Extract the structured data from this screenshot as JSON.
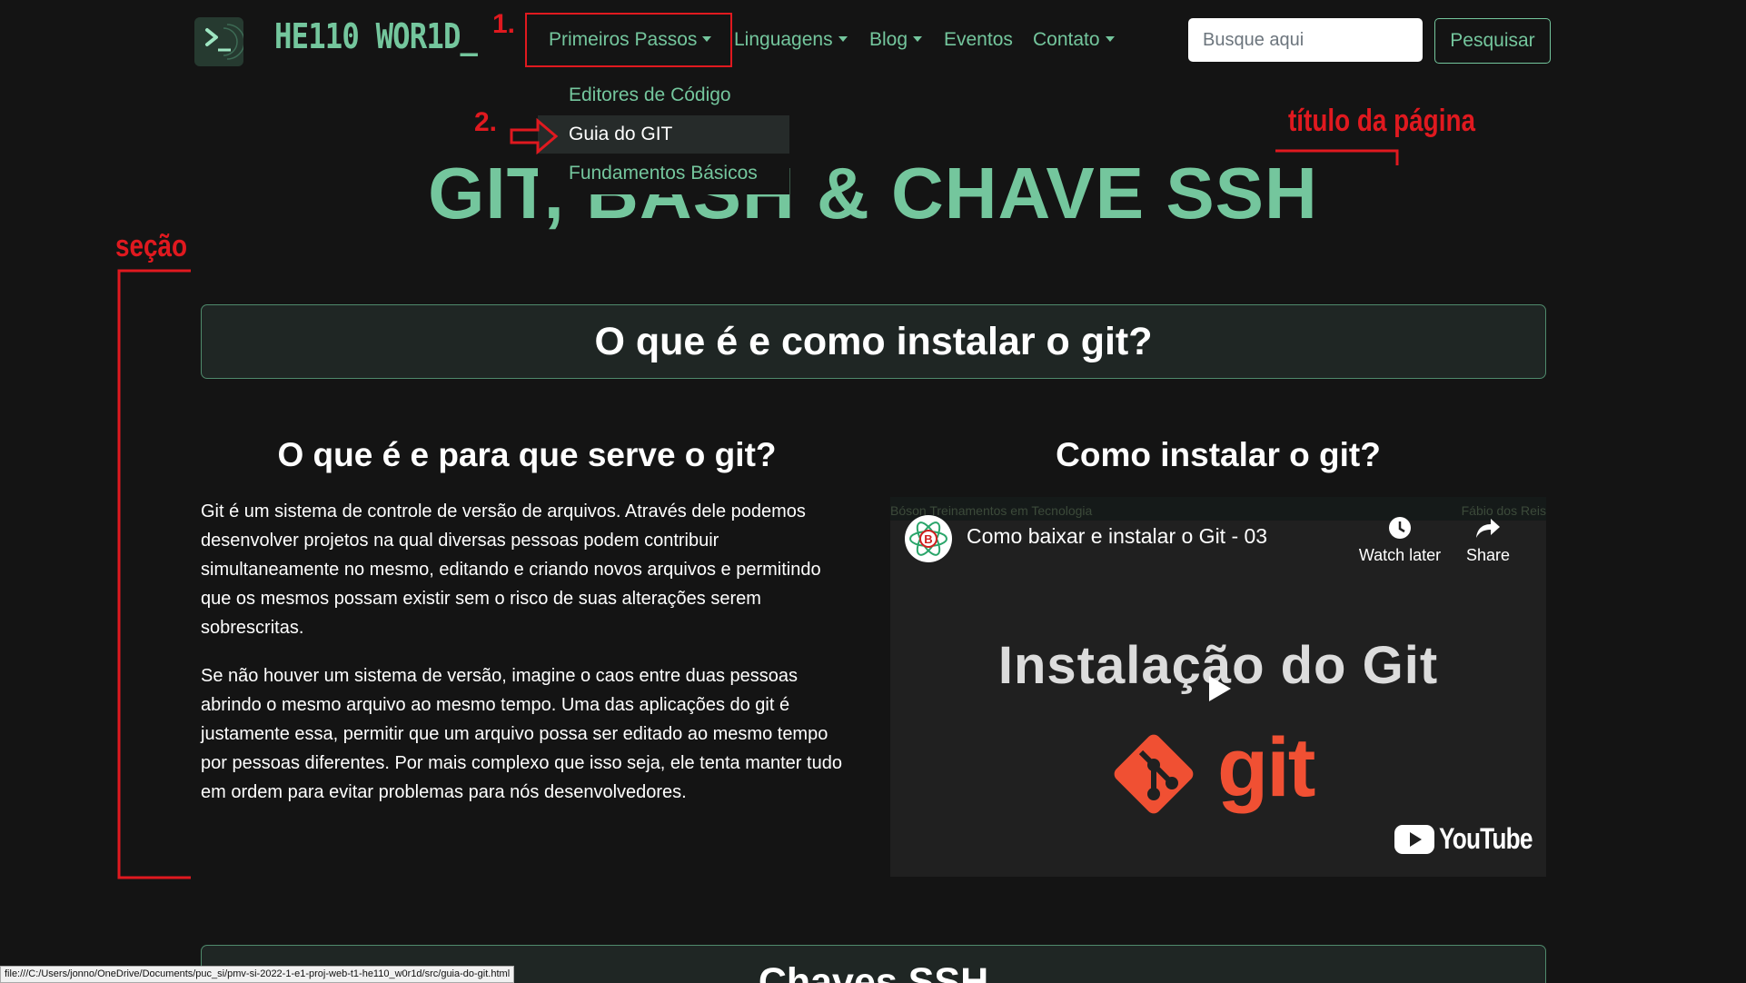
{
  "brand": {
    "name": "HE110 WOR1D_"
  },
  "nav": {
    "items": [
      {
        "label": "Primeiros Passos",
        "dropdown": true
      },
      {
        "label": "Linguagens",
        "dropdown": true
      },
      {
        "label": "Blog",
        "dropdown": true
      },
      {
        "label": "Eventos",
        "dropdown": false
      },
      {
        "label": "Contato",
        "dropdown": true
      }
    ],
    "search_placeholder": "Busque aqui",
    "search_button": "Pesquisar"
  },
  "dropdown": {
    "items": [
      {
        "label": "Editores de Código",
        "active": false
      },
      {
        "label": "Guia do GIT",
        "active": true
      },
      {
        "label": "Fundamentos Básicos",
        "active": false
      }
    ]
  },
  "page_title": "GIT, BASH & CHAVE SSH",
  "section": {
    "header": "O que é e como instalar o git?",
    "left_title": "O que é e para que serve o git?",
    "paragraphs": [
      "Git é um sistema de controle de versão de arquivos. Através dele podemos desenvolver projetos na qual diversas pessoas podem contribuir simultaneamente no mesmo, editando e criando novos arquivos e permitindo que os mesmos possam existir sem o risco de suas alterações serem sobrescritas.",
      "Se não houver um sistema de versão, imagine o caos entre duas pessoas abrindo o mesmo arquivo ao mesmo tempo. Uma das aplicações do git é justamente essa, permitir que um arquivo possa ser editado ao mesmo tempo por pessoas diferentes. Por mais complexo que isso seja, ele tenta manter tudo em ordem para evitar problemas para nós desenvolvedores."
    ],
    "right_title": "Como instalar o git?"
  },
  "video": {
    "strip_left": "Bóson Treinamentos em Tecnologia",
    "strip_right": "Fábio dos Reis",
    "title": "Como baixar e instalar o Git - 03",
    "watch_later": "Watch later",
    "share": "Share",
    "thumb_heading": "Instalação do Git",
    "thumb_logo_text": "git",
    "platform": "YouTube",
    "colors": {
      "git_orange": "#f05033",
      "youtube_white": "#ffffff"
    }
  },
  "next_section": {
    "header": "Chaves SSH"
  },
  "statusbar": {
    "url": "file:///C:/Users/jonno/OneDrive/Documents/puc_si/pmv-si-2022-1-e1-proj-web-t1-he110_w0r1d/src/guia-do-git.html"
  },
  "annotations": {
    "step1": "1.",
    "step2": "2.",
    "page_title_label": "título da página",
    "section_label": "seção"
  },
  "colors": {
    "accent": "#74c69d",
    "background": "#141414",
    "annotation_red": "#e0191f",
    "section_bg": "#1f2624"
  }
}
